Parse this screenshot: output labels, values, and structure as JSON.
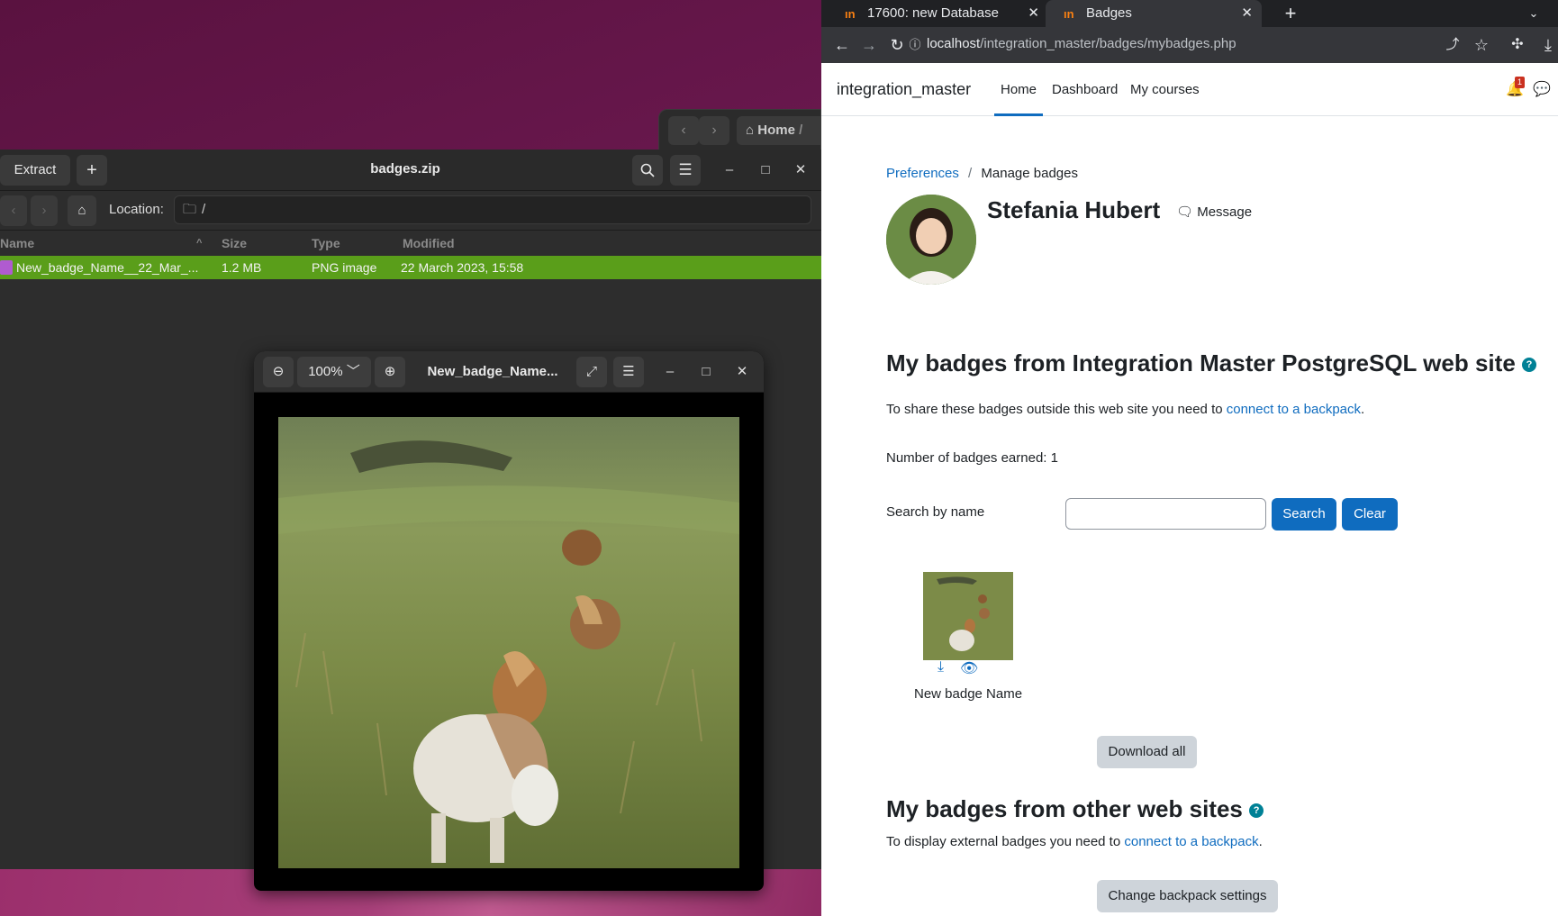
{
  "archive": {
    "title": "badges.zip",
    "extract_label": "Extract",
    "location_label": "Location:",
    "location_value": "/",
    "columns": [
      "Name",
      "Size",
      "Type",
      "Modified"
    ],
    "rows": [
      {
        "name": "New_badge_Name__22_Mar_...",
        "size": "1.2 MB",
        "type": "PNG image",
        "modified": "22 March 2023, 15:58"
      }
    ]
  },
  "files_window": {
    "path_home": "Home",
    "path_sep": "/"
  },
  "viewer": {
    "zoom": "100%",
    "title": "New_badge_Name..."
  },
  "browser": {
    "tabs": [
      {
        "label": "17600: new Database",
        "favicon": "moodle-icon"
      },
      {
        "label": "Badges",
        "favicon": "moodle-icon"
      }
    ],
    "url_host": "localhost",
    "url_path": "/integration_master/badges/mybadges.php"
  },
  "moodle": {
    "site_name": "integration_master",
    "nav": [
      "Home",
      "Dashboard",
      "My courses"
    ],
    "notification_count": "1",
    "breadcrumb": {
      "parent": "Preferences",
      "sep": "/",
      "current": "Manage badges"
    },
    "user_name": "Stefania Hubert",
    "message_label": "Message",
    "heading1": "My badges from Integration Master PostgreSQL web site",
    "share_text": "To share these badges outside this web site you need to ",
    "share_link": "connect to a backpack",
    "share_end": ".",
    "count_text": "Number of badges earned: 1",
    "search_label": "Search by name",
    "search_value": "",
    "search_button": "Search",
    "clear_button": "Clear",
    "badge_name": "New badge Name",
    "download_all": "Download all",
    "heading2": "My badges from other web sites",
    "external_text": "To display external badges you need to ",
    "external_link": "connect to a backpack",
    "external_end": ".",
    "change_backpack": "Change backpack settings",
    "accent": "#0f6cbf"
  }
}
